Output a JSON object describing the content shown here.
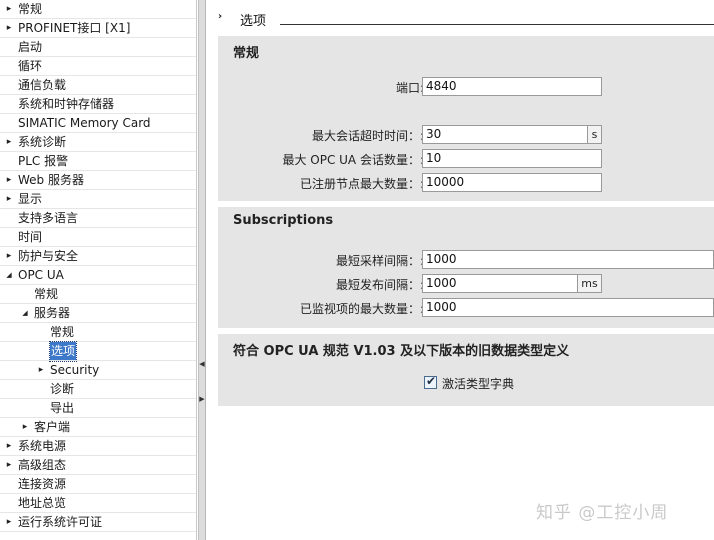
{
  "tree": {
    "items": [
      {
        "label": "常规",
        "arrow": "right"
      },
      {
        "label": "PROFINET接口 [X1]",
        "arrow": "right"
      },
      {
        "label": "启动"
      },
      {
        "label": "循环"
      },
      {
        "label": "通信负载"
      },
      {
        "label": "系统和时钟存储器"
      },
      {
        "label": "SIMATIC Memory Card"
      },
      {
        "label": "系统诊断",
        "arrow": "right"
      },
      {
        "label": "PLC 报警"
      },
      {
        "label": "Web 服务器",
        "arrow": "right"
      },
      {
        "label": "显示",
        "arrow": "right"
      },
      {
        "label": "支持多语言"
      },
      {
        "label": "时间"
      },
      {
        "label": "防护与安全",
        "arrow": "right"
      },
      {
        "label": "OPC UA",
        "arrow": "down"
      },
      {
        "label": "常规"
      },
      {
        "label": "服务器",
        "arrow": "down"
      },
      {
        "label": "常规"
      },
      {
        "label": "选项",
        "selected": true
      },
      {
        "label": "Security",
        "arrow": "right"
      },
      {
        "label": "诊断"
      },
      {
        "label": "导出"
      },
      {
        "label": "客户端",
        "arrow": "right"
      },
      {
        "label": "系统电源",
        "arrow": "right"
      },
      {
        "label": "高级组态",
        "arrow": "right"
      },
      {
        "label": "连接资源"
      },
      {
        "label": "地址总览"
      },
      {
        "label": "运行系统许可证",
        "arrow": "right"
      }
    ]
  },
  "header": {
    "title": "选项"
  },
  "general": {
    "title": "常规",
    "port": {
      "label": "端口:",
      "value": "4840"
    },
    "timeout": {
      "label": "最大会话超时时间：:",
      "value": "30",
      "unit": "s"
    },
    "sessions": {
      "label": "最大 OPC UA 会话数量：:",
      "value": "10"
    },
    "nodes": {
      "label": "已注册节点最大数量：:",
      "value": "10000"
    }
  },
  "subscriptions": {
    "title": "Subscriptions",
    "sampling": {
      "label": "最短采样间隔：:",
      "value": "1000"
    },
    "publishing": {
      "label": "最短发布间隔：:",
      "value": "1000",
      "unit": "ms"
    },
    "monitored": {
      "label": "已监视项的最大数量：:",
      "value": "1000"
    }
  },
  "legacy": {
    "title": "符合 OPC UA 规范 V1.03 及以下版本的旧数据类型定义",
    "checkbox": {
      "label": "激活类型字典",
      "checked": true
    }
  },
  "watermark": "知乎 @工控小周",
  "icons": {
    "arrow_right": "▸",
    "arrow_down": "◢",
    "check": "✔",
    "splitter_left": "◀",
    "splitter_right": "▶",
    "breadcrumb": "›"
  }
}
